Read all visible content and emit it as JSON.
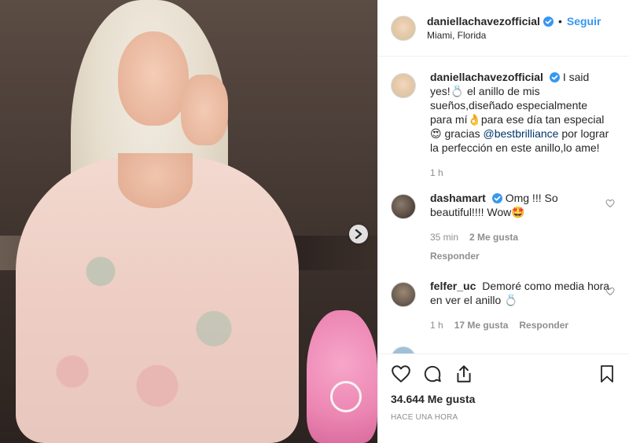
{
  "post": {
    "username": "daniellachavezofficial",
    "location": "Miami, Florida",
    "follow_label": "Seguir",
    "caption": "I said yes!💍 el anillo de mis sueños,diseñado especialmente para mí👌para ese día tan especial 😍 gracias",
    "caption_mention": "@bestbrilliance",
    "caption_end": "por lograr la perfección en este anillo,lo ame!",
    "caption_time": "1 h",
    "likes": "34.644 Me gusta",
    "posted": "HACE UNA HORA"
  },
  "comments": [
    {
      "username": "dashamart",
      "text": "Omg !!! So beautiful!!!! Wow🤩",
      "time": "35 min",
      "likes": "2 Me gusta",
      "reply": "Responder"
    },
    {
      "username": "felfer_uc",
      "text": "Demoré como media hora en ver el anillo 💍",
      "time": "1 h",
      "likes": "17 Me gusta",
      "reply": "Responder"
    }
  ],
  "icons": {
    "next": "chevron-right-icon",
    "like": "heart-icon",
    "comment": "comment-icon",
    "share": "share-icon",
    "save": "bookmark-icon",
    "verified": "verified-badge-icon"
  },
  "colors": {
    "accent": "#3897f0",
    "verified": "#3897f0",
    "text": "#262626",
    "muted": "#8e8e8e"
  }
}
